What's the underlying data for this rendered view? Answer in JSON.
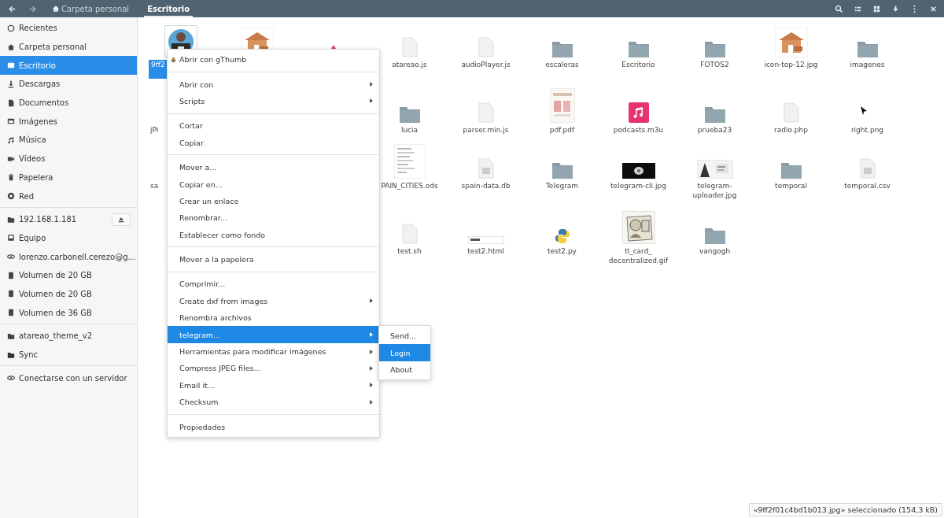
{
  "header": {
    "path": [
      {
        "label": "Carpeta personal",
        "kind": "home",
        "selected": false
      },
      {
        "label": "Escritorio",
        "kind": "folder",
        "selected": true
      }
    ]
  },
  "sidebar": {
    "sections": [
      [
        {
          "label": "Recientes",
          "selected": false
        },
        {
          "label": "Carpeta personal",
          "selected": false
        },
        {
          "label": "Escritorio",
          "selected": true
        },
        {
          "label": "Descargas",
          "selected": false
        },
        {
          "label": "Documentos",
          "selected": false
        },
        {
          "label": "Imágenes",
          "selected": false
        },
        {
          "label": "Música",
          "selected": false
        },
        {
          "label": "Vídeos",
          "selected": false
        },
        {
          "label": "Papelera",
          "selected": false
        },
        {
          "label": "Red",
          "selected": false
        }
      ],
      [
        {
          "label": "192.168.1.181",
          "selected": false,
          "eject": true
        },
        {
          "label": "Equipo",
          "selected": false
        },
        {
          "label": "lorenzo.carbonell.cerezo@g...",
          "selected": false
        },
        {
          "label": "Volumen de 20 GB",
          "selected": false
        },
        {
          "label": "Volumen de 20 GB",
          "selected": false
        },
        {
          "label": "Volumen de 36 GB",
          "selected": false
        }
      ],
      [
        {
          "label": "atareao_theme_v2",
          "selected": false
        },
        {
          "label": "Sync",
          "selected": false
        }
      ],
      [
        {
          "label": "Conectarse con un servidor",
          "selected": false
        }
      ]
    ]
  },
  "files": {
    "rows": [
      [
        {
          "label": "9ff2",
          "selected": true
        },
        {
          "kind": "house-image"
        },
        {
          "kind": "triangle"
        },
        {
          "kind": "text",
          "label": "atareao.js",
          "selected": false
        },
        {
          "kind": "text",
          "label": "audioPlayer.js",
          "selected": false
        },
        {
          "kind": "folder",
          "label": "escaleras",
          "selected": false
        },
        {
          "kind": "folder",
          "label": "Escritorio",
          "selected": false
        },
        {
          "kind": "folder",
          "label": "FOTOS2",
          "selected": false
        },
        {
          "kind": "house-image",
          "label": "icon-top-12.jpg",
          "selected": false
        },
        {
          "kind": "folder",
          "label": "imagenes",
          "selected": false
        }
      ],
      [
        {
          "kind": "hidden",
          "label": "jPi",
          "selected": false
        },
        {
          "kind": "hidden"
        },
        {
          "kind": "hidden"
        },
        {
          "kind": "folder",
          "label": "lucia",
          "selected": false
        },
        {
          "kind": "text",
          "label": "parser.min.js",
          "selected": false
        },
        {
          "kind": "pdf",
          "label": "pdf.pdf",
          "selected": false
        },
        {
          "kind": "audio",
          "label": "podcasts.m3u",
          "selected": false
        },
        {
          "kind": "folder",
          "label": "prueba23",
          "selected": false
        },
        {
          "kind": "text",
          "label": "radio.php",
          "selected": false
        },
        {
          "kind": "cursor-image",
          "label": "right.png",
          "selected": false
        }
      ],
      [
        {
          "kind": "hidden",
          "label": "sa",
          "selected": false
        },
        {
          "kind": "hidden"
        },
        {
          "kind": "hidden"
        },
        {
          "kind": "spreadsheet",
          "label": "PAIN_CITIES.ods",
          "selected": false
        },
        {
          "kind": "data",
          "label": "spain-data.db",
          "selected": false
        },
        {
          "kind": "folder",
          "label": "Telegram",
          "selected": false
        },
        {
          "kind": "dark-image",
          "label": "telegram-cli.jpg",
          "selected": false
        },
        {
          "kind": "screenshot",
          "label": "telegram-uploader.jpg",
          "selected": false
        },
        {
          "kind": "folder",
          "label": "temporal",
          "selected": false
        },
        {
          "kind": "data",
          "label": "temporal.csv",
          "selected": false
        }
      ],
      [
        {
          "kind": "hidden"
        },
        {
          "kind": "hidden"
        },
        {
          "kind": "hidden"
        },
        {
          "kind": "text",
          "label": "test.sh",
          "selected": false
        },
        {
          "kind": "html",
          "label": "test2.html",
          "selected": false
        },
        {
          "kind": "python",
          "label": "test2.py",
          "selected": false
        },
        {
          "kind": "sketch",
          "label": "tl_card_\ndecentralized.gif",
          "selected": false
        },
        {
          "kind": "folder",
          "label": "vangogh",
          "selected": false
        }
      ]
    ]
  },
  "context_menu": {
    "sections": [
      [
        {
          "label": "Abrir con gThumb",
          "icon": true,
          "submenu": false,
          "selected": false
        }
      ],
      [
        {
          "label": "Abrir con",
          "submenu": true,
          "selected": false
        },
        {
          "label": "Scripts",
          "submenu": true,
          "selected": false
        }
      ],
      [
        {
          "label": "Cortar",
          "submenu": false,
          "selected": false
        },
        {
          "label": "Copiar",
          "submenu": false,
          "selected": false
        }
      ],
      [
        {
          "label": "Mover a...",
          "submenu": false,
          "selected": false
        },
        {
          "label": "Copiar en...",
          "submenu": false,
          "selected": false
        },
        {
          "label": "Crear un enlace",
          "submenu": false,
          "selected": false
        },
        {
          "label": "Renombrar...",
          "submenu": false,
          "selected": false
        },
        {
          "label": "Establecer como fondo",
          "submenu": false,
          "selected": false
        }
      ],
      [
        {
          "label": "Mover a la papelera",
          "submenu": false,
          "selected": false
        }
      ],
      [
        {
          "label": "Comprimir...",
          "submenu": false,
          "selected": false
        },
        {
          "label": "Create dxf from images",
          "submenu": true,
          "selected": false
        },
        {
          "label": "Renombra archivos",
          "submenu": false,
          "selected": false
        },
        {
          "label": "telegram...",
          "submenu": true,
          "selected": true
        },
        {
          "label": "Herramientas para modificar imágenes",
          "submenu": true,
          "selected": false
        },
        {
          "label": "Compress JPEG files...",
          "submenu": true,
          "selected": false
        },
        {
          "label": "Email it...",
          "submenu": true,
          "selected": false
        },
        {
          "label": "Checksum",
          "submenu": true,
          "selected": false
        }
      ],
      [
        {
          "label": "Propiedades",
          "submenu": false,
          "selected": false
        }
      ]
    ],
    "submenu": [
      {
        "label": "Send...",
        "selected": false
      },
      {
        "label": "Login",
        "selected": true
      },
      {
        "label": "About",
        "selected": false
      }
    ]
  },
  "status": "«9ff2f01c4bd1b013.jpg» seleccionado (154,3 kB)"
}
